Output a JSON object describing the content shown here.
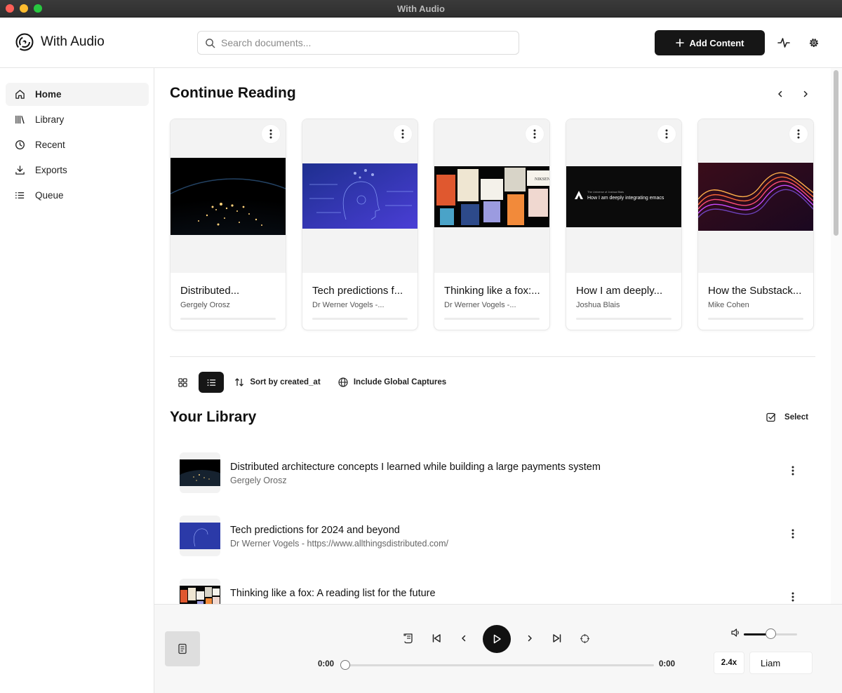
{
  "window": {
    "title": "With Audio"
  },
  "header": {
    "app_name": "With Audio",
    "search_placeholder": "Search documents...",
    "add_content_label": "Add Content"
  },
  "sidebar": {
    "items": [
      {
        "label": "Home",
        "icon": "home-icon",
        "active": true
      },
      {
        "label": "Library",
        "icon": "library-icon",
        "active": false
      },
      {
        "label": "Recent",
        "icon": "clock-icon",
        "active": false
      },
      {
        "label": "Exports",
        "icon": "download-icon",
        "active": false
      },
      {
        "label": "Queue",
        "icon": "list-icon",
        "active": false
      }
    ]
  },
  "continue_reading": {
    "title": "Continue Reading",
    "cards": [
      {
        "title": "Distributed...",
        "author": "Gergely Orosz",
        "image": "earth-night-lights",
        "progress": 0
      },
      {
        "title": "Tech predictions f...",
        "author": "Dr Werner Vogels -...",
        "image": "blue-ai-head",
        "progress": 0
      },
      {
        "title": "Thinking like a fox:...",
        "author": "Dr Werner Vogels -...",
        "image": "book-covers",
        "progress": 0
      },
      {
        "title": "How I am deeply...",
        "author": "Joshua Blais",
        "image": "emacs-title-slide",
        "progress": 0,
        "image_text": {
          "small": "The Universe of Joshua Blais",
          "big": "How I am deeply integrating emacs"
        }
      },
      {
        "title": "How the Substack...",
        "author": "Mike Cohen",
        "image": "abstract-waves",
        "progress": 0
      }
    ]
  },
  "toolbar": {
    "sort_label": "Sort by created_at",
    "global_label": "Include Global Captures",
    "view_mode": "list"
  },
  "library": {
    "title": "Your Library",
    "select_label": "Select",
    "items": [
      {
        "title": "Distributed architecture concepts I learned while building a large payments system",
        "subtitle": "Gergely Orosz",
        "image": "earth-night-lights"
      },
      {
        "title": "Tech predictions for 2024 and beyond",
        "subtitle": "Dr Werner Vogels - https://www.allthingsdistributed.com/",
        "image": "blue-ai-head"
      },
      {
        "title": "Thinking like a fox: A reading list for the future",
        "subtitle": "",
        "image": "book-covers"
      }
    ]
  },
  "player": {
    "current_time": "0:00",
    "total_time": "0:00",
    "progress": 0,
    "volume": 0.5,
    "speed": "2.4x",
    "voice": "Liam"
  },
  "colors": {
    "primary": "#161616",
    "accent_blue": "#3b49c9",
    "background": "#ffffff"
  }
}
